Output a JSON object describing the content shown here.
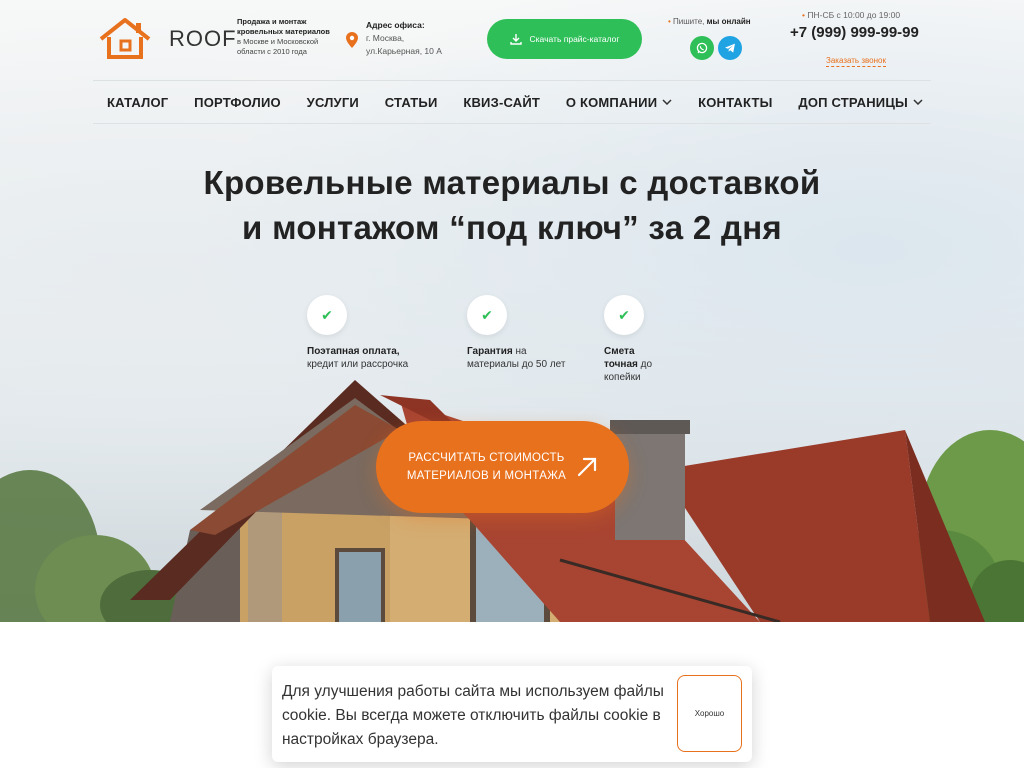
{
  "header": {
    "logo_text": "ROOF",
    "tagline_bold": "Продажа и монтаж кровельных материалов",
    "tagline_rest": "в Москве и Московской области с 2010 года",
    "address_label": "Адрес офиса:",
    "address_line1": "г. Москва,",
    "address_line2": "ул.Карьерная, 10 А",
    "catalog_button": "Скачать прайс-каталог",
    "online_prefix": "Пишите,",
    "online_bold": "мы онлайн",
    "hours": "ПН-СБ с 10:00 до 19:00",
    "phone": "+7 (999) 999-99-99",
    "callback": "Заказать звонок"
  },
  "nav": {
    "items": [
      {
        "label": "КАТАЛОГ",
        "dropdown": false
      },
      {
        "label": "ПОРТФОЛИО",
        "dropdown": false
      },
      {
        "label": "УСЛУГИ",
        "dropdown": false
      },
      {
        "label": "СТАТЬИ",
        "dropdown": false
      },
      {
        "label": "КВИЗ-САЙТ",
        "dropdown": false
      },
      {
        "label": "О КОМПАНИИ",
        "dropdown": true
      },
      {
        "label": "КОНТАКТЫ",
        "dropdown": false
      },
      {
        "label": "ДОП СТРАНИЦЫ",
        "dropdown": true
      }
    ]
  },
  "hero": {
    "headline_line1": "Кровельные материалы с доставкой",
    "headline_line2": "и монтажом “под ключ” за 2 дня",
    "features": [
      {
        "bold": "Поэтапная оплата,",
        "rest": "кредит или рассрочка"
      },
      {
        "bold": "Гарантия",
        "rest": "на материалы до 50 лет"
      },
      {
        "bold": "Смета точная",
        "rest": "до копейки"
      }
    ],
    "cta_line1": "РАССЧИТАТЬ СТОИМОСТЬ",
    "cta_line2": "МАТЕРИАЛОВ И МОНТАЖА",
    "cta_icon": "arrow-up-right-icon"
  },
  "cookie": {
    "text": "Для улучшения работы сайта мы используем файлы cookie. Вы всегда можете отключить файлы cookie в настройках браузера.",
    "button": "Хорошо"
  },
  "colors": {
    "accent_orange": "#e8711e",
    "accent_green": "#2fbf58",
    "telegram_blue": "#1fa3e3"
  }
}
